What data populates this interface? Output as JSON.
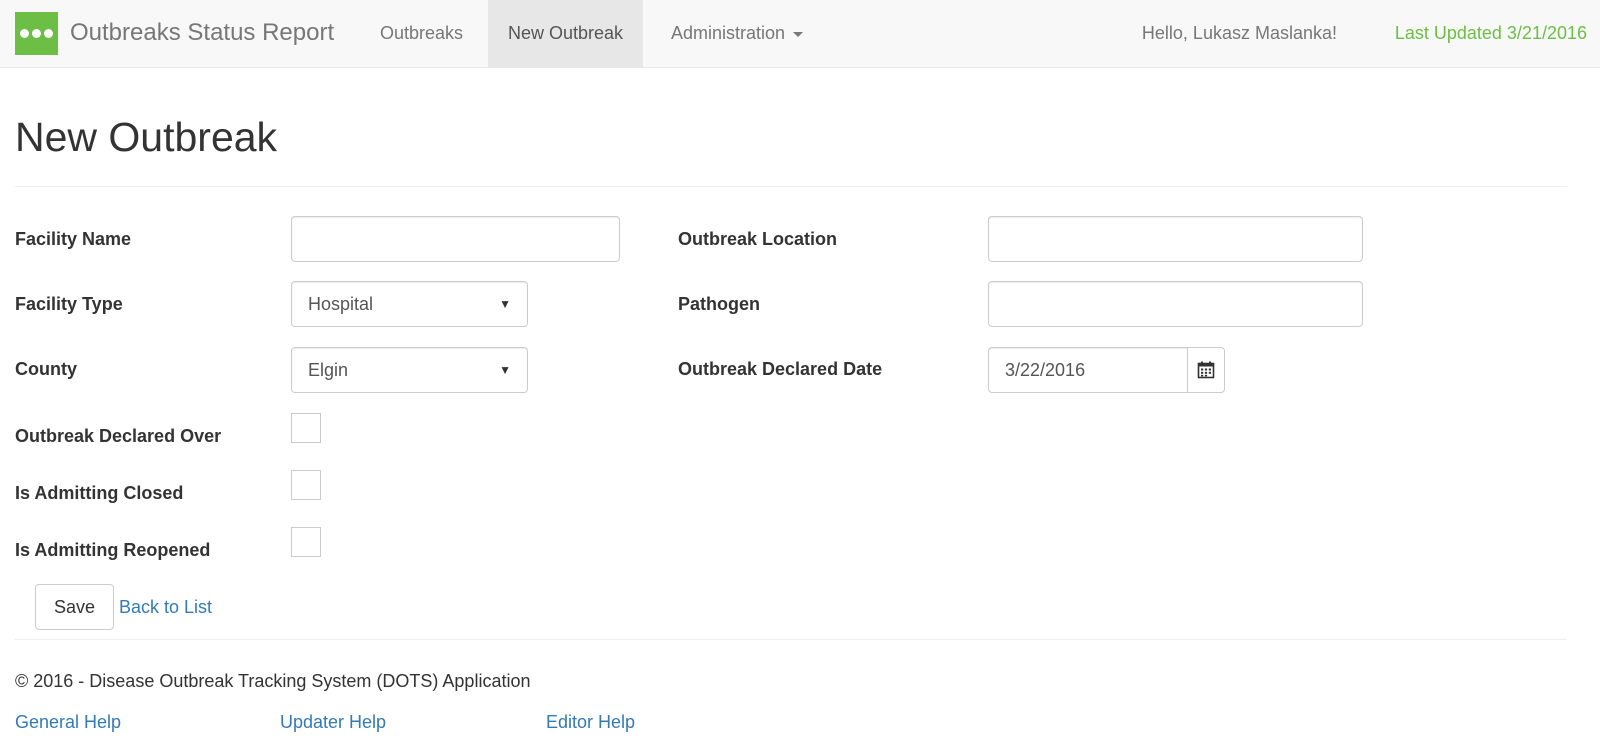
{
  "navbar": {
    "brand_title": "Outbreaks Status Report",
    "logo_icon": "three-dots-icon",
    "items": [
      {
        "label": "Outbreaks",
        "active": false
      },
      {
        "label": "New Outbreak",
        "active": true
      },
      {
        "label": "Administration",
        "active": false,
        "has_dropdown": true
      }
    ],
    "greeting": "Hello, Lukasz Maslanka!",
    "last_updated": "Last Updated 3/21/2016",
    "accent_color": "#6cbe45"
  },
  "page": {
    "title": "New Outbreak"
  },
  "form": {
    "facility_name": {
      "label": "Facility Name",
      "value": ""
    },
    "facility_type": {
      "label": "Facility Type",
      "value": "Hospital"
    },
    "county": {
      "label": "County",
      "value": "Elgin"
    },
    "outbreak_declared_over": {
      "label": "Outbreak Declared Over",
      "checked": false
    },
    "is_admitting_closed": {
      "label": "Is Admitting Closed",
      "checked": false
    },
    "is_admitting_reopened": {
      "label": "Is Admitting Reopened",
      "checked": false
    },
    "outbreak_location": {
      "label": "Outbreak Location",
      "value": ""
    },
    "pathogen": {
      "label": "Pathogen",
      "value": ""
    },
    "outbreak_declared_date": {
      "label": "Outbreak Declared Date",
      "value": "3/22/2016",
      "icon": "calendar-icon"
    }
  },
  "actions": {
    "save_label": "Save",
    "back_label": "Back to List"
  },
  "footer": {
    "copyright": "© 2016 - Disease Outbreak Tracking System (DOTS) Application",
    "links": [
      "General Help",
      "Updater Help",
      "Editor Help"
    ],
    "link_color": "#337ab7"
  }
}
